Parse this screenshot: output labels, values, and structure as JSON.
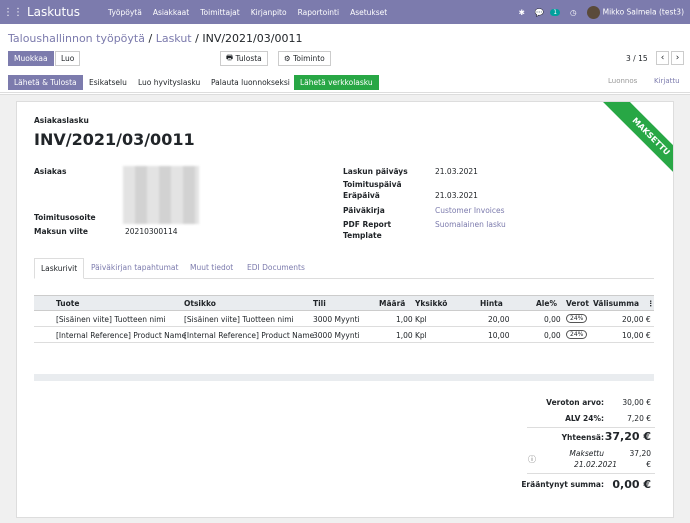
{
  "nav": {
    "app": "Laskutus",
    "menu": [
      "Työpöytä",
      "Asiakkaat",
      "Toimittajat",
      "Kirjanpito",
      "Raportointi",
      "Asetukset"
    ],
    "badge": "1",
    "user": "Mikko Salmela (test3)"
  },
  "breadcrumb": {
    "part1": "Taloushallinnon työpöytä",
    "sep1": "/",
    "part2": "Laskut",
    "sep2": "/",
    "current": "INV/2021/03/0011"
  },
  "actions": {
    "edit": "Muokkaa",
    "create": "Luo",
    "print": "Tulosta",
    "action": "Toiminto"
  },
  "pager": {
    "value": "3 / 15",
    "prev": "‹",
    "next": "›"
  },
  "status_buttons": {
    "send_print": "Lähetä & Tulosta",
    "preview": "Esikatselu",
    "credit_note": "Luo hyvityslasku",
    "reset_draft": "Palauta luonnokseksi",
    "send_einvoice": "Lähetä verkkolasku"
  },
  "status_stages": [
    "Luonnos",
    "Kirjattu"
  ],
  "ribbon": "MAKSETTU",
  "invoice": {
    "type": "Asiakaslasku",
    "number": "INV/2021/03/0011",
    "customer_label": "Asiakas",
    "delivery_label": "Toimitusosoite",
    "ref_label": "Maksun viite",
    "ref_value": "20210300114",
    "invoice_date_label": "Laskun päiväys",
    "invoice_date": "21.03.2021",
    "delivery_date_label": "Toimituspäivä",
    "due_label": "Eräpäivä",
    "due_date": "21.03.2021",
    "journal_label": "Päiväkirja",
    "journal": "Customer Invoices",
    "pdf_label": "PDF Report",
    "pdf_label2": "Template",
    "pdf_value": "Suomalainen lasku"
  },
  "tabs": [
    "Laskurivit",
    "Päiväkirjan tapahtumat",
    "Muut tiedot",
    "EDI Documents"
  ],
  "table": {
    "headers": [
      "Tuote",
      "Otsikko",
      "Tili",
      "Määrä",
      "Yksikkö",
      "Hinta",
      "Ale%",
      "Verot",
      "Välisumma"
    ],
    "rows": [
      [
        "[Sisäinen viite] Tuotteen nimi",
        "[Sisäinen viite] Tuotteen nimi",
        "3000 Myynti",
        "1,00",
        "Kpl",
        "20,00",
        "0,00",
        "24%",
        "20,00 €"
      ],
      [
        "[Internal Reference] Product Name",
        "[Internal Reference] Product Name",
        "3000 Myynti",
        "1,00",
        "Kpl",
        "10,00",
        "0,00",
        "24%",
        "10,00 €"
      ]
    ]
  },
  "totals": {
    "untaxed_label": "Veroton arvo:",
    "untaxed": "30,00 €",
    "vat_label": "ALV 24%:",
    "vat": "7,20 €",
    "total_label": "Yhteensä:",
    "total": "37,20 €",
    "paid_label": "Maksettu",
    "paid_date": "21.02.2021",
    "paid_amount": "37,20",
    "paid_currency": "€",
    "due_label": "Erääntynyt summa:",
    "due": "0,00 €"
  }
}
